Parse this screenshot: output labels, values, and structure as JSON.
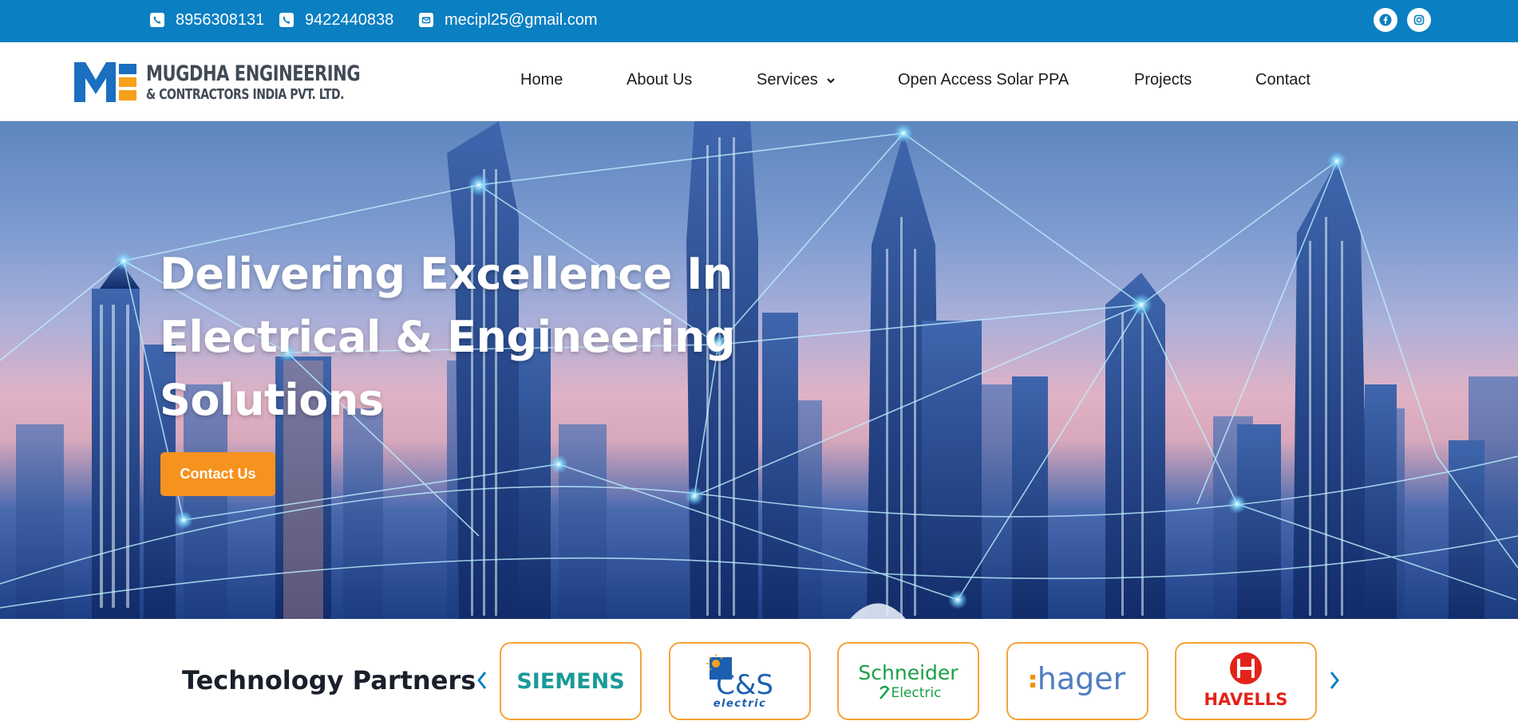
{
  "topbar": {
    "phone1": "8956308131",
    "phone2": "9422440838",
    "email": "mecipl25@gmail.com",
    "icons": [
      "phone-icon",
      "phone-icon",
      "email-icon",
      "facebook-icon",
      "instagram-icon"
    ]
  },
  "brand": {
    "line1": "MUGDHA ENGINEERING",
    "line2": "& CONTRACTORS INDIA PVT. LTD.",
    "colors": {
      "blue": "#1a6fc0",
      "orange": "#f6a11c"
    }
  },
  "nav": {
    "items": [
      {
        "label": "Home"
      },
      {
        "label": "About Us"
      },
      {
        "label": "Services"
      },
      {
        "label": "Open Access Solar PPA"
      },
      {
        "label": "Projects"
      },
      {
        "label": "Contact"
      }
    ]
  },
  "hero": {
    "title_line1": "Delivering Excellence In",
    "title_line2": "Electrical & Engineering",
    "title_line3": "Solutions",
    "cta_label": "Contact Us"
  },
  "partners": {
    "title": "Technology Partners",
    "logos": [
      {
        "name": "SIEMENS"
      },
      {
        "name": "C&S",
        "sub": "electric"
      },
      {
        "name": "Schneider",
        "sub": "Electric"
      },
      {
        "name": "hager"
      },
      {
        "name": "HAVELLS"
      }
    ]
  },
  "colors": {
    "topbar": "#0a7fc2",
    "accent": "#f6921e",
    "card_border": "#f6a33a",
    "arrow": "#0a7fc2"
  }
}
